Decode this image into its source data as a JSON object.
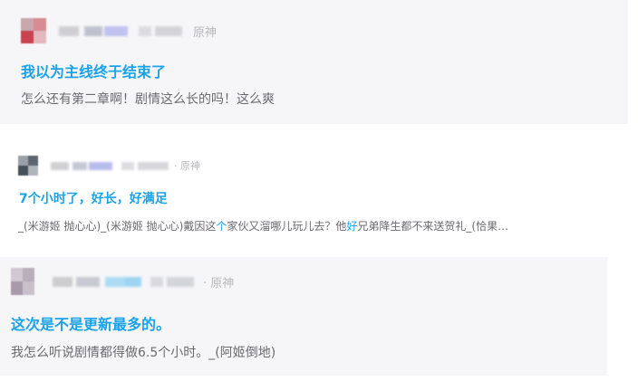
{
  "colors": {
    "accent": "#1ba2e8",
    "card_bg": "#f6f6f8",
    "preview_text": "#6a6a70",
    "forum_tag": "#b8b8bd"
  },
  "posts": [
    {
      "forum": "原神",
      "title": "我以为主线终于结束了",
      "preview": "怎么还有第二章啊！剧情这么长的吗！这么爽"
    },
    {
      "forum": "· 原神",
      "title": "7个小时了，好长，好满足",
      "preview_parts": [
        "_(米游姬 抛心心)_(米游姬 抛心心)戴因这",
        "个",
        "家伙又溜哪儿玩儿去？他",
        "好",
        "兄弟降生都不来送贺礼_(恰果…"
      ]
    },
    {
      "forum": "· 原神",
      "title": "这次是不是更新最多的。",
      "preview": "我怎么听说剧情都得做6.5个小时。_(阿姬倒地)"
    }
  ]
}
